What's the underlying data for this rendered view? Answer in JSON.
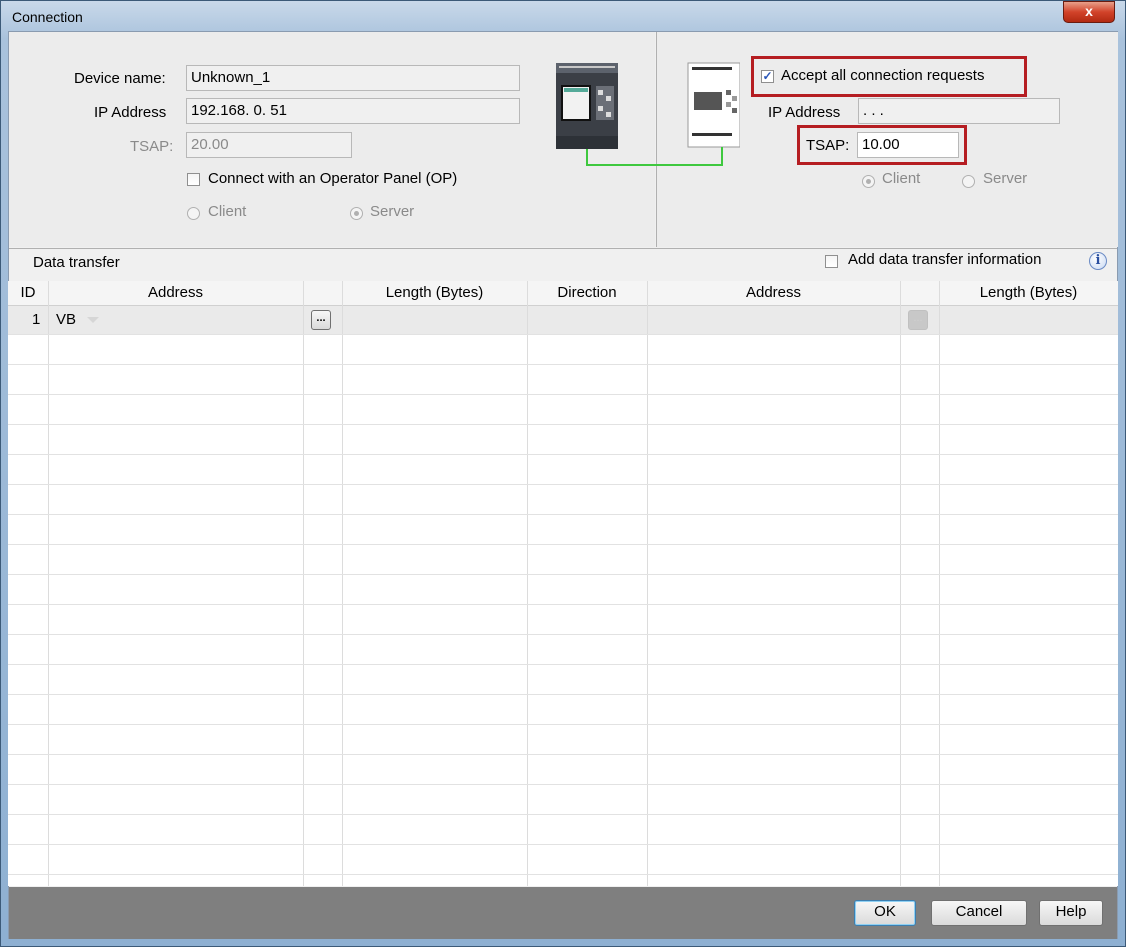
{
  "window": {
    "title": "Connection",
    "close_label": "x"
  },
  "local": {
    "device_name_label": "Device name:",
    "device_name_value": "Unknown_1",
    "ip_label": "IP Address",
    "ip_value": "192.168.  0. 51",
    "tsap_label": "TSAP:",
    "tsap_value": "20.00",
    "op_checkbox_label": "Connect with an Operator Panel (OP)",
    "op_checked": false,
    "client_label": "Client",
    "server_label": "Server",
    "selected_mode": "Server"
  },
  "remote": {
    "accept_label": "Accept all connection requests",
    "accept_checked": true,
    "ip_label": "IP Address",
    "ip_value": ".   .   .",
    "tsap_label": "TSAP:",
    "tsap_value": "10.00",
    "client_label": "Client",
    "server_label": "Server",
    "selected_mode": "Client"
  },
  "data_transfer": {
    "section_label": "Data transfer",
    "add_info_label": "Add data transfer information",
    "add_info_checked": false,
    "info_icon": "i",
    "columns": [
      "ID",
      "Address",
      "",
      "Length (Bytes)",
      "Direction",
      "Address",
      "",
      "Length (Bytes)"
    ],
    "rows": [
      {
        "id": "1",
        "address": "VB",
        "browse_label": "...",
        "length": "",
        "direction": "",
        "remote_address": "",
        "remote_browse_label": "...",
        "remote_length": ""
      }
    ]
  },
  "footer": {
    "ok_label": "OK",
    "cancel_label": "Cancel",
    "help_label": "Help"
  },
  "colors": {
    "highlight": "#b51d22",
    "link_line": "#3ec83e",
    "footer": "#7f7f7f"
  }
}
